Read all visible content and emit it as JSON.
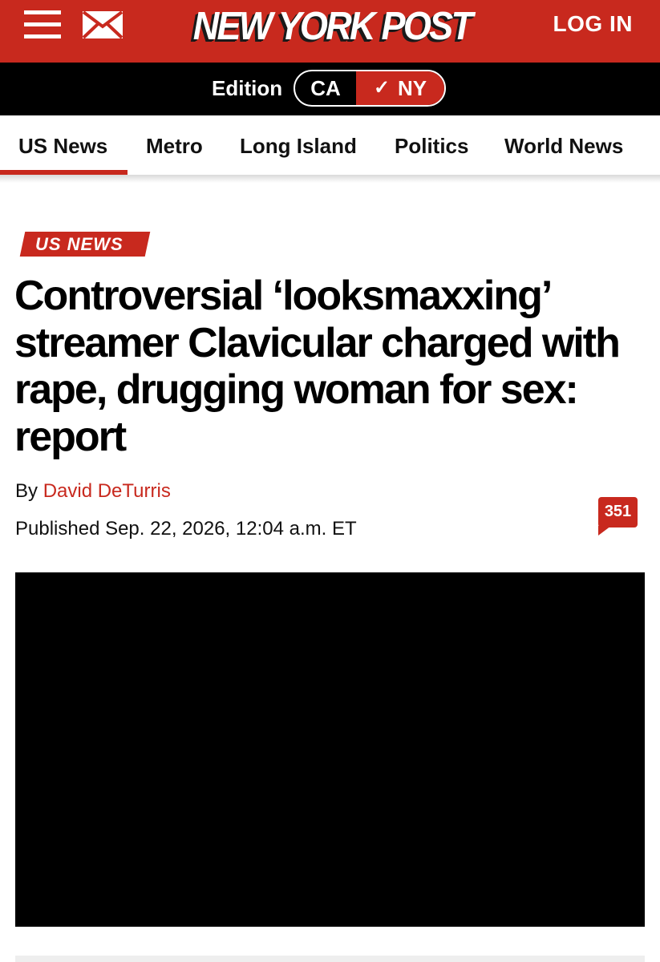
{
  "header": {
    "logo_text": "NEW YORK POST",
    "login_label": "LOG IN",
    "menu_icon": "hamburger-menu-icon",
    "mail_icon": "envelope-icon",
    "brand_red": "#c8291e"
  },
  "edition": {
    "label": "Edition",
    "options": [
      "CA",
      "NY"
    ],
    "selected": "NY",
    "check_glyph": "✓"
  },
  "nav": {
    "items": [
      "US News",
      "Metro",
      "Long Island",
      "Politics",
      "World News"
    ],
    "active": "US News"
  },
  "article": {
    "section_tag": "US NEWS",
    "headline": "Controversial ‘looksmaxxing’ streamer Clavicular charged with rape, drugging woman for sex: report",
    "by_prefix": "By",
    "author": "David DeTurris",
    "published": "Published Sep. 22, 2026, 12:04 a.m. ET",
    "comment_count": "351"
  }
}
